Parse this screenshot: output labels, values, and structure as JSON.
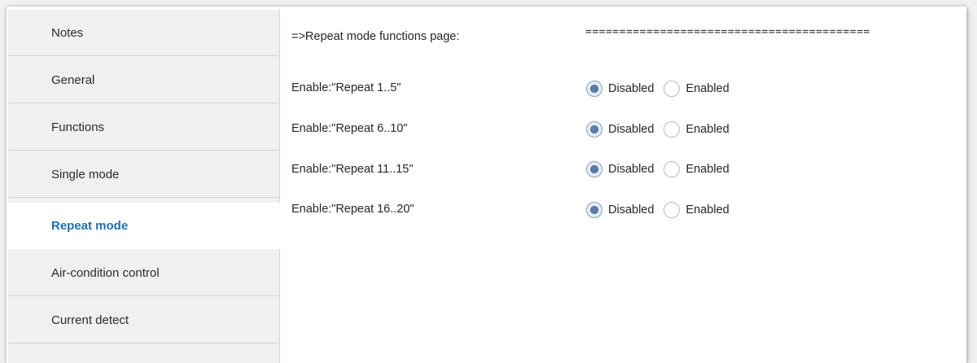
{
  "sidebar": {
    "items": [
      {
        "label": "Notes",
        "active": false
      },
      {
        "label": "General",
        "active": false
      },
      {
        "label": "Functions",
        "active": false
      },
      {
        "label": "Single mode",
        "active": false
      },
      {
        "label": "Repeat mode",
        "active": true
      },
      {
        "label": "Air-condition control",
        "active": false
      },
      {
        "label": "Current detect",
        "active": false
      }
    ],
    "active_color": "#1f6fb2"
  },
  "content": {
    "header": {
      "label": "=>Repeat mode functions page:",
      "separator": "=====================================​====="
    },
    "params": [
      {
        "label": "Enable:\"Repeat 1..5\"",
        "options": [
          "Disabled",
          "Enabled"
        ],
        "selected": "Disabled"
      },
      {
        "label": "Enable:\"Repeat 6..10\"",
        "options": [
          "Disabled",
          "Enabled"
        ],
        "selected": "Disabled"
      },
      {
        "label": "Enable:\"Repeat 11..15\"",
        "options": [
          "Disabled",
          "Enabled"
        ],
        "selected": "Disabled"
      },
      {
        "label": "Enable:\"Repeat 16..20\"",
        "options": [
          "Disabled",
          "Enabled"
        ],
        "selected": "Disabled"
      }
    ]
  }
}
